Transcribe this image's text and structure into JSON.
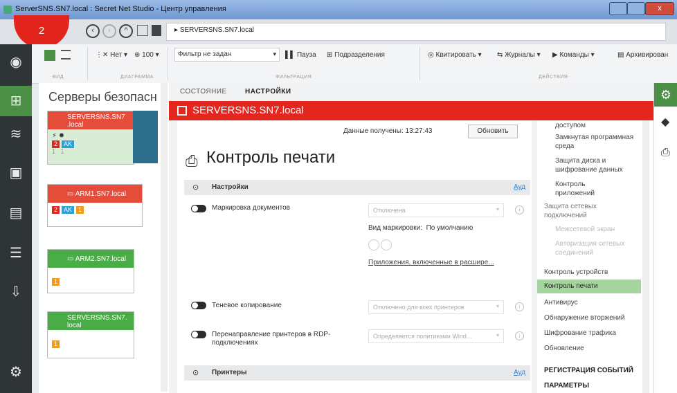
{
  "window": {
    "title": "ServerSNS.SN7.local : Secret Net Studio - Центр управления"
  },
  "address": {
    "badge": "2",
    "path": "SERVERSNS.SN7.local"
  },
  "ribbon": {
    "view_caption": "ВИД",
    "diagram_caption": "ДИАГРАММА",
    "no_label": "Нет",
    "zoom_value": "100",
    "filter_value": "Фильтр не задан",
    "pause_label": "Пауза",
    "units_label": "Подразделения",
    "filtration_caption": "ФИЛЬТРАЦИЯ",
    "ack_label": "Квитировать",
    "logs_label": "Журналы",
    "commands_label": "Команды",
    "archive_label": "Архивирован",
    "actions_caption": "ДЕЙСТВИЯ"
  },
  "servers": {
    "title": "Серверы безопасн",
    "cards": [
      {
        "name": "SERVERSNS.SN7\n.local",
        "color": "#e54c3a",
        "badges": [
          "2",
          "AK"
        ],
        "nums": [
          "1",
          "1"
        ]
      },
      {
        "name": "ARM1.SN7.local",
        "color": "#e54c3a",
        "badges": [
          "2",
          "AK",
          "1"
        ]
      },
      {
        "name": "ARM2.SN7.local",
        "color": "#48ad46",
        "badges": [
          "1"
        ]
      },
      {
        "name": "SERVERSNS.SN7.\nlocal",
        "color": "#48ad46",
        "badges": [
          "1"
        ]
      }
    ]
  },
  "main": {
    "tabs": [
      "СОСТОЯНИЕ",
      "НАСТРОЙКИ"
    ],
    "server": "SERVERSNS.SN7.local",
    "received_label": "Данные получены:",
    "received_time": "13:27:43",
    "refresh_button": "Обновить",
    "page_title": "Контроль печати",
    "settings_section": "Настройки",
    "printers_section": "Принтеры",
    "section_link": "Ауд",
    "rows": [
      {
        "label": "Маркировка документов",
        "value": "Отключена"
      },
      {
        "label": "Теневое копирование",
        "value": "Отключено для всех принтеров"
      },
      {
        "label": "Перенаправление принтеров в RDP-подключениях",
        "value": "Определяется политиками Wind..."
      }
    ],
    "mark_type_label": "Вид маркировки:",
    "mark_type_value": "По умолчанию",
    "apps_link": "Приложения, включенные в расшире..."
  },
  "nav": {
    "items": [
      "доступом",
      "Замкнутая программная среда",
      "Защита диска и шифрование данных",
      "Контроль приложений",
      "Защита сетевых подключений",
      "Межсетевой экран",
      "Авторизация сетевых соединений",
      "Контроль устройств",
      "Контроль печати",
      "Антивирус",
      "Обнаружение вторжений",
      "Шифрование трафика",
      "Обновление"
    ],
    "group_events": "РЕГИСТРАЦИЯ СОБЫТИЙ",
    "group_params": "ПАРАМЕТРЫ"
  }
}
